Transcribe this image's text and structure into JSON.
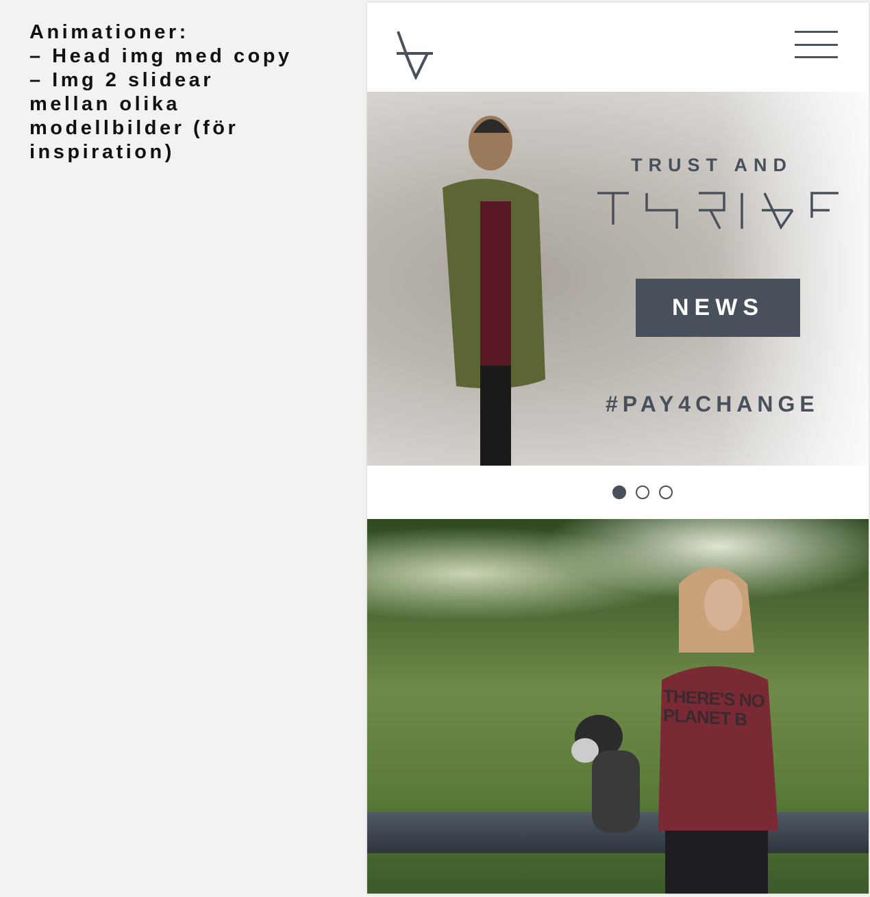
{
  "notes": {
    "text": "Animationer:\n– Head img med copy\n– Img 2 slidear\nmellan olika\nmodellbilder (för\ninspiration)"
  },
  "header": {
    "logo_icon": "trust-and-thrive-mark",
    "menu_icon": "hamburger-icon"
  },
  "hero": {
    "tagline": "TRUST AND",
    "logotype": "THRIVE",
    "news_button": "NEWS",
    "hashtag": "#PAY4CHANGE"
  },
  "carousel": {
    "slide_count": 3,
    "active_index": 0
  },
  "photo2": {
    "shirt_text": "THERE'S NO\nPLANET B"
  },
  "colors": {
    "brand": "#47505b",
    "background": "#f2f2f2"
  }
}
